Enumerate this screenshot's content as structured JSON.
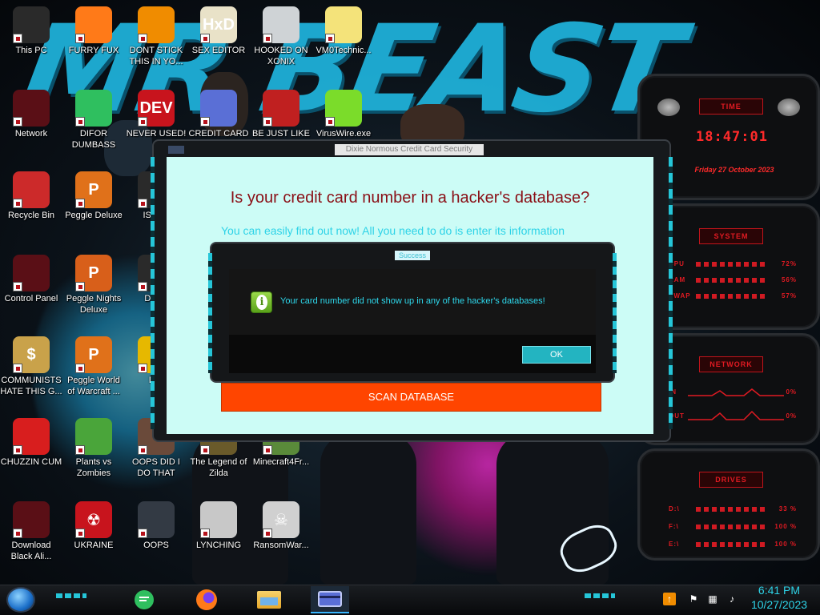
{
  "desktop": {
    "icons": [
      {
        "label": "This PC",
        "glyph": "pc-icon",
        "color": "#2a2a2a",
        "text": ""
      },
      {
        "label": "FURRY FUX",
        "glyph": "firefox-icon",
        "color": "#ff7a18",
        "text": ""
      },
      {
        "label": "DONT STICK THIS IN YO...",
        "glyph": "vlc-cone-icon",
        "color": "#f08c00",
        "text": ""
      },
      {
        "label": "SEX EDITOR",
        "glyph": "hxd-icon",
        "color": "#e9e2c8",
        "text": "HxD"
      },
      {
        "label": "HOOKED ON XONIX",
        "glyph": "xonix-icon",
        "color": "#cfd3d6",
        "text": ""
      },
      {
        "label": "VM0Technic...",
        "glyph": "cartoon-face-icon",
        "color": "#f4e37a",
        "text": ""
      },
      {
        "label": "Network",
        "glyph": "network-icon",
        "color": "#5a0f16",
        "text": ""
      },
      {
        "label": "DIFOR DUMBASS",
        "glyph": "discord-icon",
        "color": "#2fbf5f",
        "text": ""
      },
      {
        "label": "NEVER USED!",
        "glyph": "dev-cpp-icon",
        "color": "#c8141d",
        "text": "DEV"
      },
      {
        "label": "CREDIT CARD",
        "glyph": "credit-card-icon",
        "color": "#5a6fd6",
        "text": ""
      },
      {
        "label": "BE JUST LIKE",
        "glyph": "santa-icon",
        "color": "#c02020",
        "text": ""
      },
      {
        "label": "VirusWire.exe",
        "glyph": "lime-icon",
        "color": "#7bdc2a",
        "text": ""
      },
      {
        "label": "Recycle Bin",
        "glyph": "recycle-bin-icon",
        "color": "#cc2a2a",
        "text": ""
      },
      {
        "label": "Peggle Deluxe",
        "glyph": "peggle-icon",
        "color": "#e0711a",
        "text": "P"
      },
      {
        "label": "ISRAE",
        "glyph": "partial-icon",
        "color": "#2a2a2a",
        "text": ""
      },
      {
        "label": "Control Panel",
        "glyph": "control-panel-icon",
        "color": "#5a0f16",
        "text": ""
      },
      {
        "label": "Peggle Nights Deluxe",
        "glyph": "peggle-nights-icon",
        "color": "#d85f1a",
        "text": "P"
      },
      {
        "label": "DEEZ",
        "glyph": "partial-icon",
        "color": "#2a2a2a",
        "text": ""
      },
      {
        "label": "COMMUNISTS HATE THIS G...",
        "glyph": "money-bag-icon",
        "color": "#c9a24a",
        "text": "$"
      },
      {
        "label": "Peggle World of Warcraft ...",
        "glyph": "peggle-wow-icon",
        "color": "#e0711a",
        "text": "P"
      },
      {
        "label": "DIE",
        "glyph": "partial-icon",
        "color": "#e6b800",
        "text": "D"
      },
      {
        "label": "CHUZZIN CUM",
        "glyph": "chuzzle-icon",
        "color": "#d81e1e",
        "text": ""
      },
      {
        "label": "Plants vs Zombies",
        "glyph": "pvz-icon",
        "color": "#4aa53a",
        "text": ""
      },
      {
        "label": "OOPS DID I DO THAT",
        "glyph": "person-icon",
        "color": "#6a4a3a",
        "text": ""
      },
      {
        "label": "The Legend of Zilda",
        "glyph": "zelda-icon",
        "color": "#6a5a2a",
        "text": ""
      },
      {
        "label": "Minecraft4Fr...",
        "glyph": "minecraft-icon",
        "color": "#5a8a3a",
        "text": ""
      },
      {
        "label": "Download Black Ali...",
        "glyph": "alienware-icon",
        "color": "#5a0f16",
        "text": ""
      },
      {
        "label": "UKRAINE",
        "glyph": "radiation-icon",
        "color": "#c8141d",
        "text": "☢"
      },
      {
        "label": "OOPS",
        "glyph": "monitor-icon",
        "color": "#333a44",
        "text": ""
      },
      {
        "label": "LYNCHING",
        "glyph": "rope-icon",
        "color": "#c8c8c8",
        "text": ""
      },
      {
        "label": "RansomWar...",
        "glyph": "skull-icon",
        "color": "#d0d0d0",
        "text": "☠"
      }
    ]
  },
  "widgets": {
    "time": {
      "title": "TIME",
      "clock": "18:47:01",
      "date": "Friday 27 October 2023"
    },
    "system": {
      "title": "SYSTEM",
      "rows": [
        {
          "label": "CPU",
          "value": "72%"
        },
        {
          "label": "RAM",
          "value": "56%"
        },
        {
          "label": "SWAP",
          "value": "57%"
        }
      ]
    },
    "network": {
      "title": "NETWORK",
      "rows": [
        {
          "label": "IN",
          "value": "0%"
        },
        {
          "label": "OUT",
          "value": "0%"
        }
      ]
    },
    "drives": {
      "title": "DRIVES",
      "rows": [
        {
          "label": "D:\\",
          "value": "33 %"
        },
        {
          "label": "F:\\",
          "value": "100 %"
        },
        {
          "label": "E:\\",
          "value": "100 %"
        }
      ]
    }
  },
  "main_window": {
    "title": "Dixie Normous Credit Card Security",
    "heading": "Is your credit card number in a hacker's database?",
    "subheading": "You can easily find out now! All you need to do is enter its information",
    "scan_button": "SCAN DATABASE"
  },
  "success_dialog": {
    "title": "Success",
    "icon": "info-icon",
    "message": "Your card number did not show up in any of the hacker's databases!",
    "ok_button": "OK"
  },
  "taskbar": {
    "items": [
      {
        "name": "discord",
        "icon": "discord-icon",
        "active": false
      },
      {
        "name": "firefox",
        "icon": "firefox-icon",
        "active": false
      },
      {
        "name": "file-explorer",
        "icon": "folder-icon",
        "active": false
      },
      {
        "name": "credit-card-app",
        "icon": "credit-card-icon",
        "active": true
      }
    ],
    "time": "6:41 PM",
    "date": "10/27/2023"
  },
  "colors": {
    "accent_cyan": "#25c6d8",
    "widget_red": "#e01a22",
    "scan_orange": "#ff4500",
    "dialog_bg": "#ccfcf6",
    "heading_red": "#8a0f16"
  }
}
